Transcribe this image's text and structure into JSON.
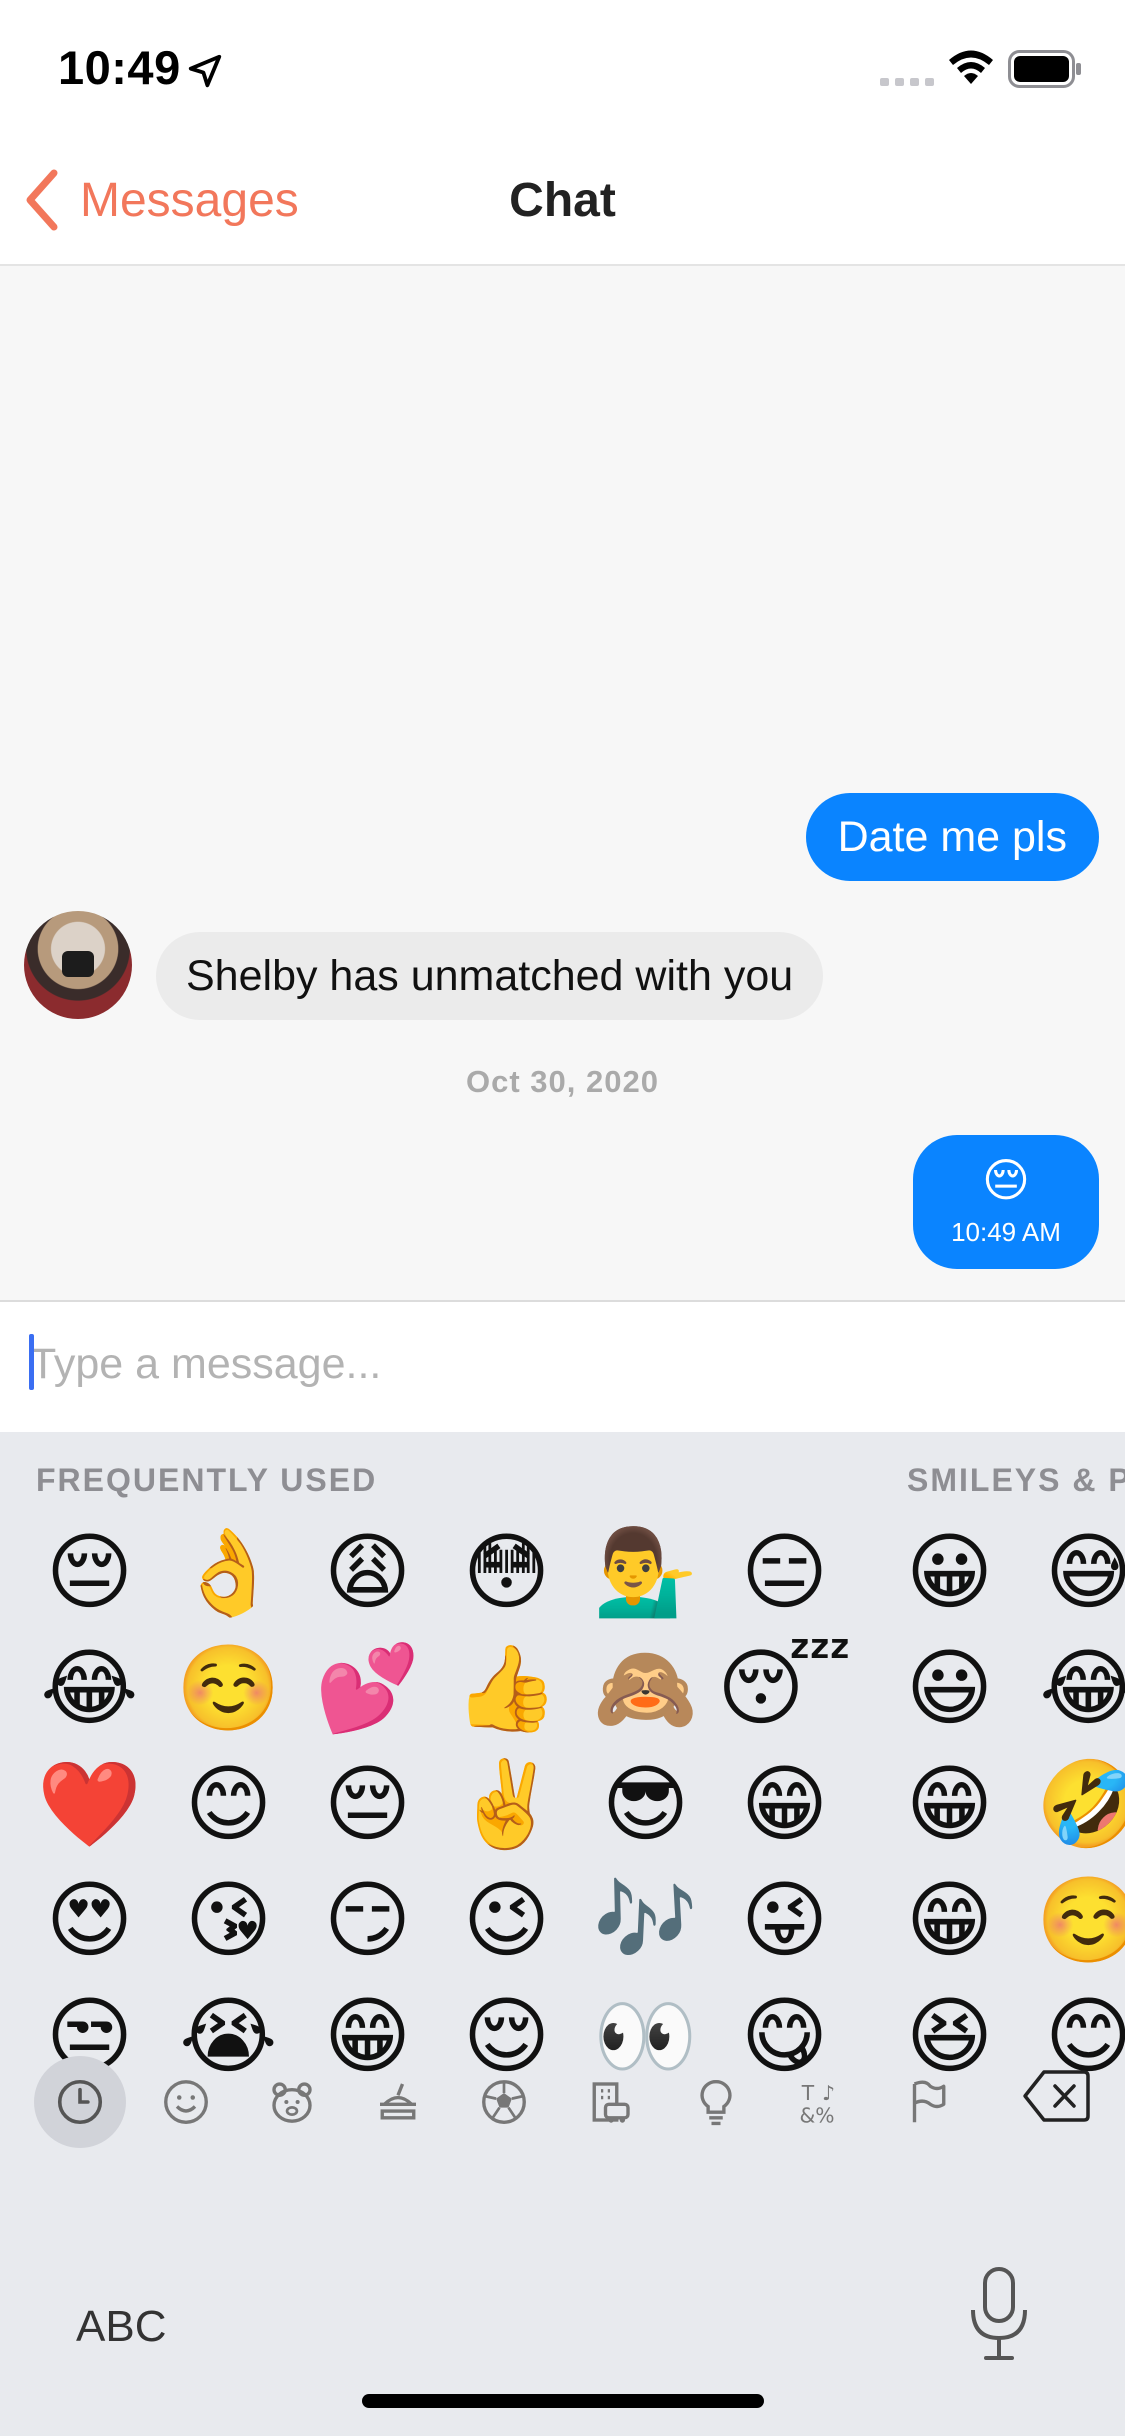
{
  "status_bar": {
    "time": "10:49"
  },
  "nav": {
    "back_label": "Messages",
    "title": "Chat"
  },
  "chat": {
    "messages": [
      {
        "text": "Date me pls",
        "direction": "outgoing"
      },
      {
        "text": "Shelby has unmatched with you",
        "direction": "incoming"
      },
      {
        "text": "😔",
        "direction": "outgoing",
        "time": "10:49 AM"
      }
    ],
    "date_separator": "Oct 30, 2020"
  },
  "input": {
    "placeholder": "Type a message...",
    "value": ""
  },
  "keyboard": {
    "sections": [
      "FREQUENTLY USED",
      "SMILEYS & P"
    ],
    "frequently_used": [
      "😔",
      "👌",
      "😩",
      "😳",
      "💁‍♂️",
      "😑",
      "😂",
      "☺️",
      "💕",
      "👍",
      "🙈",
      "😴",
      "❤️",
      "😊",
      "😔",
      "✌️",
      "😎",
      "😁",
      "😍",
      "😘",
      "😏",
      "😉",
      "🎶",
      "😜",
      "😒",
      "😭",
      "😁",
      "😌",
      "👀",
      "😋"
    ],
    "smileys_partial": [
      "😀",
      "😅",
      "😃",
      "😂",
      "😁",
      "🤣",
      "😁",
      "☺️",
      "😆",
      "😊"
    ],
    "categories": [
      "recent",
      "smileys",
      "animals",
      "food",
      "activity",
      "travel",
      "objects",
      "symbols",
      "flags"
    ],
    "abc_label": "ABC"
  },
  "colors": {
    "accent": "#f2775b",
    "outgoing_bubble": "#0a84ff",
    "incoming_bubble": "#ebebeb",
    "keyboard_bg": "#e8eaee"
  }
}
